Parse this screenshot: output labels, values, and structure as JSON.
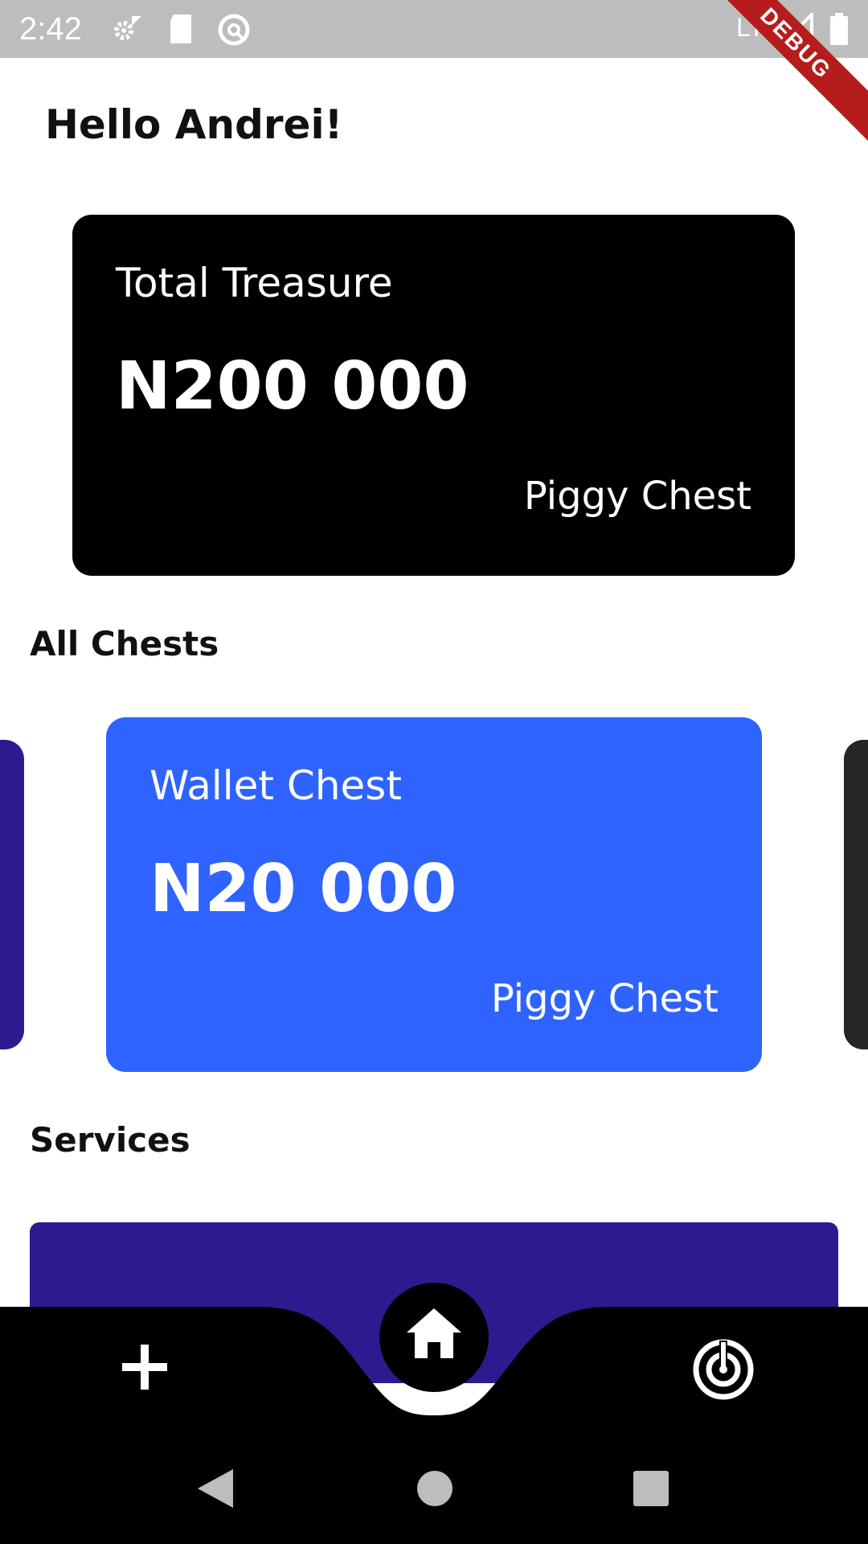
{
  "status_bar": {
    "time": "2:42",
    "network": "LTE",
    "icons": [
      "settings-gear-icon",
      "sd-card-icon",
      "vpn-badge-icon",
      "signal-icon",
      "battery-icon"
    ]
  },
  "debug_banner": "DEBUG",
  "greeting": "Hello Andrei!",
  "total_card": {
    "label": "Total Treasure",
    "amount": "N200 000",
    "subtitle": "Piggy Chest",
    "color": "#000000"
  },
  "all_chests": {
    "title": "All Chests",
    "current": {
      "label": "Wallet Chest",
      "amount": "N20 000",
      "subtitle": "Piggy Chest",
      "color": "#2E63FF"
    },
    "prev_color": "#2E1A8F",
    "next_color": "#262626"
  },
  "services": {
    "title": "Services",
    "card_color": "#2E1A8F"
  },
  "bottom_nav": {
    "items": [
      "add-icon",
      "home-icon",
      "radar-icon"
    ],
    "active": "home-icon"
  },
  "system_nav": [
    "back-icon",
    "home-circle-icon",
    "recents-icon"
  ]
}
